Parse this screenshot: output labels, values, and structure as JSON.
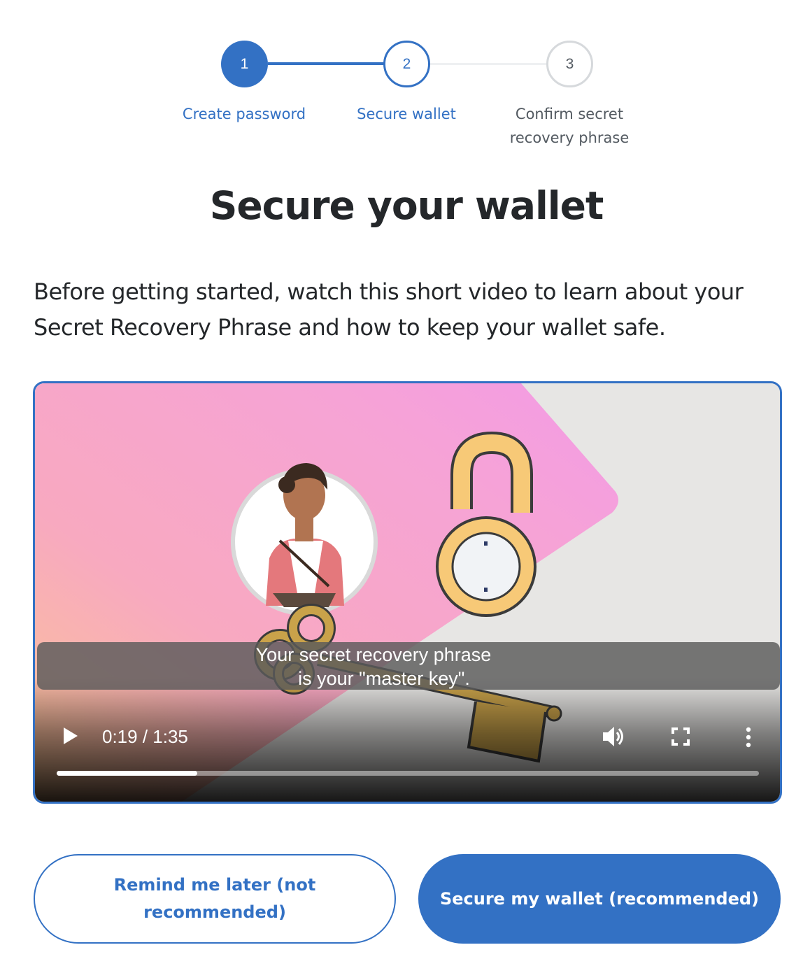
{
  "stepper": {
    "steps": [
      {
        "number": "1",
        "label": "Create password",
        "state": "complete"
      },
      {
        "number": "2",
        "label": "Secure wallet",
        "state": "active"
      },
      {
        "number": "3",
        "label": "Confirm secret recovery phrase",
        "state": "upcoming"
      }
    ]
  },
  "page": {
    "title": "Secure your wallet",
    "description": "Before getting started, watch this short video to learn about your Secret Recovery Phrase and how to keep your wallet safe."
  },
  "video": {
    "caption_line1": "Your secret recovery phrase",
    "caption_line2": "is your \"master key\".",
    "current_time": "0:19",
    "duration": "1:35",
    "time_display": "0:19 / 1:35",
    "progress_fraction": 0.2,
    "icons": [
      "play-icon",
      "volume-icon",
      "fullscreen-icon",
      "more-options-icon"
    ]
  },
  "buttons": {
    "remind_later": "Remind me later (not recommended)",
    "secure_wallet": "Secure my wallet (recommended)"
  },
  "colors": {
    "accent": "#3371c4",
    "text": "#24272a",
    "muted": "#535a61"
  }
}
